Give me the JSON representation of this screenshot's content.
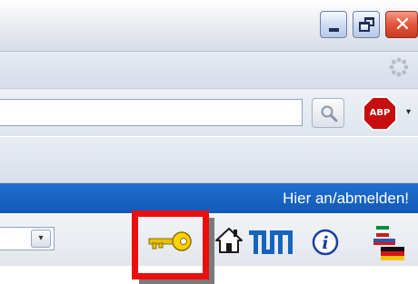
{
  "window": {
    "controls": {
      "minimize_icon": "minimize-icon",
      "maximize_icon": "restore-icon",
      "close_icon": "close-icon",
      "close_glyph": "✕"
    }
  },
  "navbar": {
    "throbber_icon": "loading-throbber-icon"
  },
  "search": {
    "value": "",
    "button_icon": "magnifier-icon"
  },
  "adblock": {
    "label": "ABP",
    "menu_arrow": "▾",
    "icon": "adblock-plus-icon"
  },
  "linkbar": {
    "text": "Hier an/abmelden!"
  },
  "toolbar": {
    "dropdown_value": "",
    "dropdown_arrow": "▾",
    "icons": [
      "key-icon",
      "home-icon",
      "tum-logo-icon",
      "info-icon",
      "language-flag-icon"
    ],
    "tum_logo_text": "TUM",
    "highlight_color": "#ea0f0f"
  },
  "colors": {
    "linkbar_blue": "#1565c0",
    "close_red": "#e2553b"
  }
}
